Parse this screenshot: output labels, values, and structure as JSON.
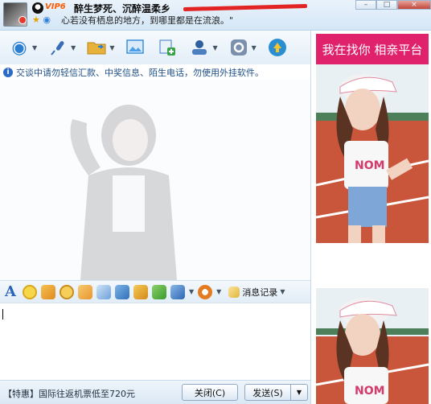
{
  "header": {
    "vip_label": "VIP6",
    "nickname": "醉生梦死、沉醉温柔乡",
    "signature": "心若没有栖息的地方，到哪里都是在流浪。\""
  },
  "window_buttons": {
    "minimize": "–",
    "maximize": "□",
    "close": "×"
  },
  "toolbar": {
    "items": [
      {
        "name": "video-chat-icon",
        "glyph": "◉",
        "color": "#2c7fd0"
      },
      {
        "name": "voice-chat-icon",
        "glyph": "🎤",
        "color": "#3a6db5"
      },
      {
        "name": "send-file-icon",
        "glyph": "📂",
        "color": "#e0a22a"
      },
      {
        "name": "image-icon",
        "glyph": "▣",
        "color": "#3c8fd9"
      },
      {
        "name": "create-group-icon",
        "glyph": "✚",
        "color": "#3aa34a"
      },
      {
        "name": "remote-assist-icon",
        "glyph": "☗",
        "color": "#2f5f9e"
      },
      {
        "name": "settings-icon",
        "glyph": "⚙",
        "color": "#5a6f8a"
      },
      {
        "name": "apps-icon",
        "glyph": "◈",
        "color": "#2a8fd0"
      }
    ]
  },
  "notice": {
    "text": "交谈中请勿轻信汇款、中奖信息、陌生电话，勿使用外挂软件。"
  },
  "input_toolbar": {
    "font_label": "A",
    "icons": [
      {
        "name": "emoji-icon",
        "color": "#f2c12e"
      },
      {
        "name": "vibrate-icon",
        "color": "#f0a030"
      },
      {
        "name": "magic-emoji-icon",
        "color": "#e3b53a"
      },
      {
        "name": "gesture-icon",
        "color": "#f0b24a"
      },
      {
        "name": "doodle-icon",
        "color": "#6fa0d8"
      },
      {
        "name": "send-image-icon",
        "color": "#4c8fd4"
      },
      {
        "name": "music-icon",
        "color": "#e0a030"
      },
      {
        "name": "gift-icon",
        "color": "#4fb042"
      },
      {
        "name": "screenshot-icon",
        "color": "#3a78c5"
      },
      {
        "name": "sogou-icon",
        "color": "#e57b20"
      }
    ],
    "history_label": "消息记录"
  },
  "bottom": {
    "promo": "【特惠】国际往返机票低至720元",
    "close_label": "关闭(C)",
    "send_label": "发送(S)"
  },
  "ad": {
    "banner_text": "我在找你 相亲平台"
  },
  "colors": {
    "accent": "#2a63b8",
    "ad_banner": "#e0216c",
    "redaction": "#e32424"
  }
}
